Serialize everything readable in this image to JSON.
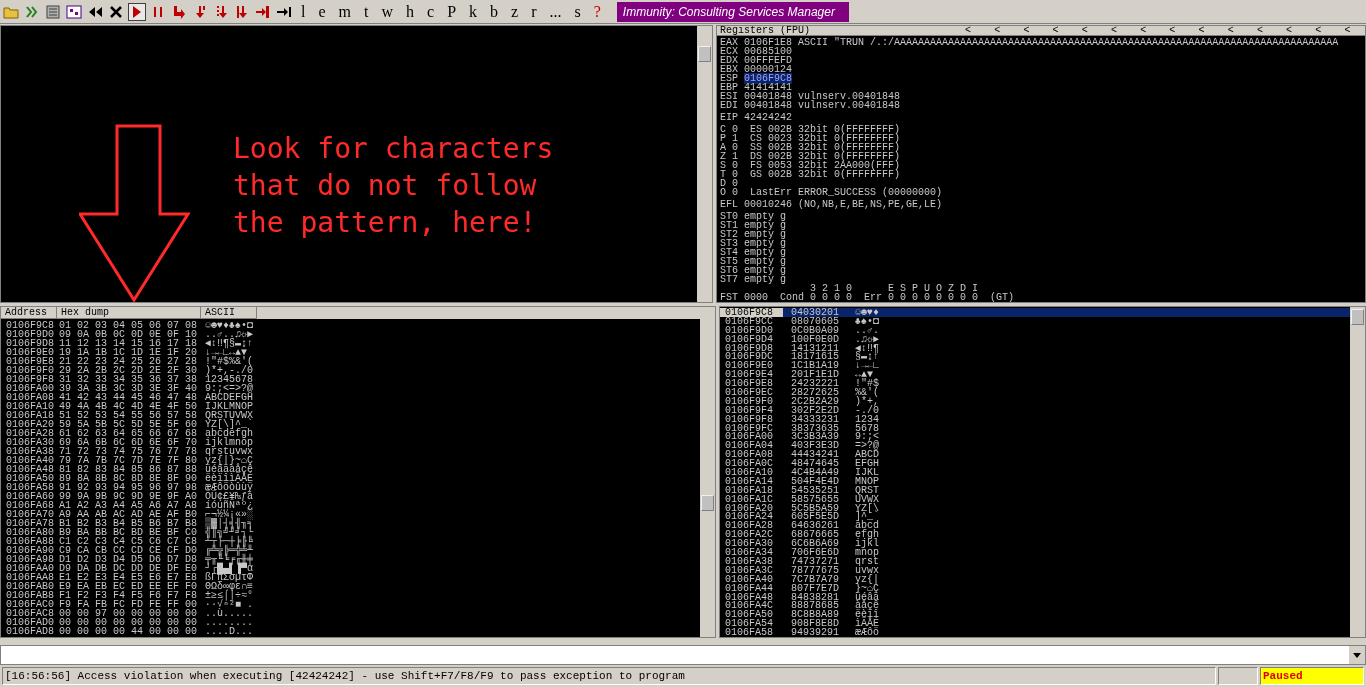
{
  "toolbar": {
    "letters": [
      {
        "label": "l",
        "kind": "window"
      },
      {
        "label": "e",
        "kind": "window"
      },
      {
        "label": "m",
        "kind": "window"
      },
      {
        "label": "t",
        "kind": "window"
      },
      {
        "label": "w",
        "kind": "window"
      },
      {
        "label": "h",
        "kind": "window"
      },
      {
        "label": "c",
        "kind": "window"
      },
      {
        "label": "P",
        "kind": "window"
      },
      {
        "label": "k",
        "kind": "window"
      },
      {
        "label": "b",
        "kind": "window"
      },
      {
        "label": "z",
        "kind": "window"
      },
      {
        "label": "r",
        "kind": "window"
      },
      {
        "label": "...",
        "kind": "window"
      },
      {
        "label": "s",
        "kind": "window"
      },
      {
        "label": "?",
        "kind": "help"
      }
    ],
    "title": "Immunity: Consulting Services Manager"
  },
  "annotation": {
    "lines": [
      "Look for characters",
      "that do not follow",
      "the pattern, here!"
    ]
  },
  "registers": {
    "title": "Registers (FPU)",
    "arrows": [
      "<",
      "<",
      "<",
      "<",
      "<",
      "<",
      "<",
      "<",
      "<",
      "<",
      "<",
      "<",
      "<",
      "<"
    ],
    "general": [
      {
        "name": "EAX",
        "value": "0106F1E8",
        "comment": "ASCII \"TRUN /.:/AAAAAAAAAAAAAAAAAAAAAAAAAAAAAAAAAAAAAAAAAAAAAAAAAAAAAAAAAAAAAAAAAAAAAAAAAA",
        "selected": false
      },
      {
        "name": "ECX",
        "value": "00685100",
        "selected": false
      },
      {
        "name": "EDX",
        "value": "00FFFEFD",
        "selected": false
      },
      {
        "name": "EBX",
        "value": "00000124",
        "selected": false
      },
      {
        "name": "ESP",
        "value": "0106F9C8",
        "selected": true
      },
      {
        "name": "EBP",
        "value": "41414141",
        "selected": false
      },
      {
        "name": "ESI",
        "value": "00401848",
        "comment": "vulnserv.00401848",
        "selected": false
      },
      {
        "name": "EDI",
        "value": "00401848",
        "comment": "vulnserv.00401848",
        "selected": false
      }
    ],
    "eip": {
      "name": "EIP",
      "value": "42424242"
    },
    "flags": [
      "C 0  ES 002B 32bit 0(FFFFFFFF)",
      "P 1  CS 0023 32bit 0(FFFFFFFF)",
      "A 0  SS 002B 32bit 0(FFFFFFFF)",
      "Z 1  DS 002B 32bit 0(FFFFFFFF)",
      "S 0  FS 0053 32bit 2AA000(FFF)",
      "T 0  GS 002B 32bit 0(FFFFFFFF)",
      "D 0",
      "O 0  LastErr ERROR_SUCCESS (00000000)"
    ],
    "efl": "EFL 00010246 (NO,NB,E,BE,NS,PE,GE,LE)",
    "fpu": [
      "ST0 empty g",
      "ST1 empty g",
      "ST2 empty g",
      "ST3 empty g",
      "ST4 empty g",
      "ST5 empty g",
      "ST6 empty g",
      "ST7 empty g"
    ],
    "fpu_status": [
      "               3 2 1 0      E S P U O Z D I",
      "FST 0000  Cond 0 0 0 0  Err 0 0 0 0 0 0 0 0  (GT)"
    ]
  },
  "dump": {
    "columns": [
      "Address",
      "Hex dump",
      "ASCII"
    ],
    "rows": [
      {
        "address": "0106F9C8",
        "hex": "01 02 03 04 05 06 07 08",
        "ascii": "☺☻♥♦♣♠•◘"
      },
      {
        "address": "0106F9D0",
        "hex": "09 0A 0B 0C 0D 0E 0F 10",
        "ascii": "..♂..♫☼►"
      },
      {
        "address": "0106F9D8",
        "hex": "11 12 13 14 15 16 17 18",
        "ascii": "◄↕‼¶§▬↨↑"
      },
      {
        "address": "0106F9E0",
        "hex": "19 1A 1B 1C 1D 1E 1F 20",
        "ascii": "↓→←∟↔▲▼"
      },
      {
        "address": "0106F9E8",
        "hex": "21 22 23 24 25 26 27 28",
        "ascii": "!\"#$%&'("
      },
      {
        "address": "0106F9F0",
        "hex": "29 2A 2B 2C 2D 2E 2F 30",
        "ascii": ")*+,-./0"
      },
      {
        "address": "0106F9F8",
        "hex": "31 32 33 34 35 36 37 38",
        "ascii": "12345678"
      },
      {
        "address": "0106FA00",
        "hex": "39 3A 3B 3C 3D 3E 3F 40",
        "ascii": "9:;<=>?@"
      },
      {
        "address": "0106FA08",
        "hex": "41 42 43 44 45 46 47 48",
        "ascii": "ABCDEFGH"
      },
      {
        "address": "0106FA10",
        "hex": "49 4A 4B 4C 4D 4E 4F 50",
        "ascii": "IJKLMNOP"
      },
      {
        "address": "0106FA18",
        "hex": "51 52 53 54 55 56 57 58",
        "ascii": "QRSTUVWX"
      },
      {
        "address": "0106FA20",
        "hex": "59 5A 5B 5C 5D 5E 5F 60",
        "ascii": "YZ[\\]^_`"
      },
      {
        "address": "0106FA28",
        "hex": "61 62 63 64 65 66 67 68",
        "ascii": "abcdefgh"
      },
      {
        "address": "0106FA30",
        "hex": "69 6A 6B 6C 6D 6E 6F 70",
        "ascii": "ijklmnop"
      },
      {
        "address": "0106FA38",
        "hex": "71 72 73 74 75 76 77 78",
        "ascii": "qrstuvwx"
      },
      {
        "address": "0106FA40",
        "hex": "79 7A 7B 7C 7D 7E 7F 80",
        "ascii": "yz{|}~⌂Ç"
      },
      {
        "address": "0106FA48",
        "hex": "81 82 83 84 85 86 87 88",
        "ascii": "üéâäàåçê"
      },
      {
        "address": "0106FA50",
        "hex": "89 8A 8B 8C 8D 8E 8F 90",
        "ascii": "ëèïîìÄÅÉ"
      },
      {
        "address": "0106FA58",
        "hex": "91 92 93 94 95 96 97 98",
        "ascii": "æÆôöòûùÿ"
      },
      {
        "address": "0106FA60",
        "hex": "99 9A 9B 9C 9D 9E 9F A0",
        "ascii": "ÖÜ¢£¥₧ƒá"
      },
      {
        "address": "0106FA68",
        "hex": "A1 A2 A3 A4 A5 A6 A7 A8",
        "ascii": "íóúñÑªº¿"
      },
      {
        "address": "0106FA70",
        "hex": "A9 AA AB AC AD AE AF B0",
        "ascii": "⌐¬½¼¡«»░"
      },
      {
        "address": "0106FA78",
        "hex": "B1 B2 B3 B4 B5 B6 B7 B8",
        "ascii": "▒▓│┤╡╢╖╕"
      },
      {
        "address": "0106FA80",
        "hex": "B9 BA BB BC BD BE BF C0",
        "ascii": "╣║╗╝╜╛┐└"
      },
      {
        "address": "0106FA88",
        "hex": "C1 C2 C3 C4 C5 C6 C7 C8",
        "ascii": "┴┬├─┼╞╟╚"
      },
      {
        "address": "0106FA90",
        "hex": "C9 CA CB CC CD CE CF D0",
        "ascii": "╔╩╦╠═╬╧╨"
      },
      {
        "address": "0106FA98",
        "hex": "D1 D2 D3 D4 D5 D6 D7 D8",
        "ascii": "╤╥╙╘╒╓╫╪"
      },
      {
        "address": "0106FAA0",
        "hex": "D9 DA DB DC DD DE DF E0",
        "ascii": "┘┌█▄▌▐▀α"
      },
      {
        "address": "0106FAA8",
        "hex": "E1 E2 E3 E4 E5 E6 E7 E8",
        "ascii": "ßΓπΣσµτΦ"
      },
      {
        "address": "0106FAB0",
        "hex": "E9 EA EB EC ED EE EF F0",
        "ascii": "ΘΩδ∞φε∩≡"
      },
      {
        "address": "0106FAB8",
        "hex": "F1 F2 F3 F4 F5 F6 F7 F8",
        "ascii": "±≥≤⌠⌡÷≈°"
      },
      {
        "address": "0106FAC0",
        "hex": "F9 FA FB FC FD FE FF 00",
        "ascii": "∙·√ⁿ²■ ."
      },
      {
        "address": "0106FAC8",
        "hex": "00 00 97 00 00 00 00 00",
        "ascii": "..ù....."
      },
      {
        "address": "0106FAD0",
        "hex": "00 00 00 00 00 00 00 00",
        "ascii": "........"
      },
      {
        "address": "0106FAD8",
        "hex": "00 00 00 00 44 00 00 00",
        "ascii": "....D..."
      }
    ]
  },
  "stack": {
    "rows": [
      {
        "address": "0106F9C8",
        "value": "04030201",
        "ascii": "☺☻♥♦",
        "selected": true
      },
      {
        "address": "0106F9CC",
        "value": "08070605",
        "ascii": "♣♠•◘",
        "selected": false
      },
      {
        "address": "0106F9D0",
        "value": "0C0B0A09",
        "ascii": "..♂.",
        "selected": false
      },
      {
        "address": "0106F9D4",
        "value": "100F0E0D",
        "ascii": ".♫☼►",
        "selected": false
      },
      {
        "address": "0106F9D8",
        "value": "14131211",
        "ascii": "◄↕‼¶",
        "selected": false
      },
      {
        "address": "0106F9DC",
        "value": "18171615",
        "ascii": "§▬↨↑",
        "selected": false
      },
      {
        "address": "0106F9E0",
        "value": "1C1B1A19",
        "ascii": "↓→←∟",
        "selected": false
      },
      {
        "address": "0106F9E4",
        "value": "201F1E1D",
        "ascii": "↔▲▼",
        "selected": false
      },
      {
        "address": "0106F9E8",
        "value": "24232221",
        "ascii": "!\"#$",
        "selected": false
      },
      {
        "address": "0106F9EC",
        "value": "28272625",
        "ascii": "%&'(",
        "selected": false
      },
      {
        "address": "0106F9F0",
        "value": "2C2B2A29",
        "ascii": ")*+,",
        "selected": false
      },
      {
        "address": "0106F9F4",
        "value": "302F2E2D",
        "ascii": "-./0",
        "selected": false
      },
      {
        "address": "0106F9F8",
        "value": "34333231",
        "ascii": "1234",
        "selected": false
      },
      {
        "address": "0106F9FC",
        "value": "38373635",
        "ascii": "5678",
        "selected": false
      },
      {
        "address": "0106FA00",
        "value": "3C3B3A39",
        "ascii": "9:;<",
        "selected": false
      },
      {
        "address": "0106FA04",
        "value": "403F3E3D",
        "ascii": "=>?@",
        "selected": false
      },
      {
        "address": "0106FA08",
        "value": "44434241",
        "ascii": "ABCD",
        "selected": false
      },
      {
        "address": "0106FA0C",
        "value": "48474645",
        "ascii": "EFGH",
        "selected": false
      },
      {
        "address": "0106FA10",
        "value": "4C4B4A49",
        "ascii": "IJKL",
        "selected": false
      },
      {
        "address": "0106FA14",
        "value": "504F4E4D",
        "ascii": "MNOP",
        "selected": false
      },
      {
        "address": "0106FA18",
        "value": "54535251",
        "ascii": "QRST",
        "selected": false
      },
      {
        "address": "0106FA1C",
        "value": "58575655",
        "ascii": "UVWX",
        "selected": false
      },
      {
        "address": "0106FA20",
        "value": "5C5B5A59",
        "ascii": "YZ[\\",
        "selected": false
      },
      {
        "address": "0106FA24",
        "value": "605F5E5D",
        "ascii": "]^_`",
        "selected": false
      },
      {
        "address": "0106FA28",
        "value": "64636261",
        "ascii": "abcd",
        "selected": false
      },
      {
        "address": "0106FA2C",
        "value": "68676665",
        "ascii": "efgh",
        "selected": false
      },
      {
        "address": "0106FA30",
        "value": "6C6B6A69",
        "ascii": "ijkl",
        "selected": false
      },
      {
        "address": "0106FA34",
        "value": "706F6E6D",
        "ascii": "mnop",
        "selected": false
      },
      {
        "address": "0106FA38",
        "value": "74737271",
        "ascii": "qrst",
        "selected": false
      },
      {
        "address": "0106FA3C",
        "value": "78777675",
        "ascii": "uvwx",
        "selected": false
      },
      {
        "address": "0106FA40",
        "value": "7C7B7A79",
        "ascii": "yz{|",
        "selected": false
      },
      {
        "address": "0106FA44",
        "value": "807F7E7D",
        "ascii": "}~⌂Ç",
        "selected": false
      },
      {
        "address": "0106FA48",
        "value": "84838281",
        "ascii": "üéâä",
        "selected": false
      },
      {
        "address": "0106FA4C",
        "value": "88878685",
        "ascii": "àåçê",
        "selected": false
      },
      {
        "address": "0106FA50",
        "value": "8C8B8A89",
        "ascii": "ëèïî",
        "selected": false
      },
      {
        "address": "0106FA54",
        "value": "908F8E8D",
        "ascii": "ìÄÅÉ",
        "selected": false
      },
      {
        "address": "0106FA58",
        "value": "94939291",
        "ascii": "æÆôö",
        "selected": false
      }
    ]
  },
  "status_bar": {
    "message": "[16:56:56] Access violation when executing [42424242] - use Shift+F7/F8/F9 to pass exception to program",
    "state": "Paused"
  }
}
